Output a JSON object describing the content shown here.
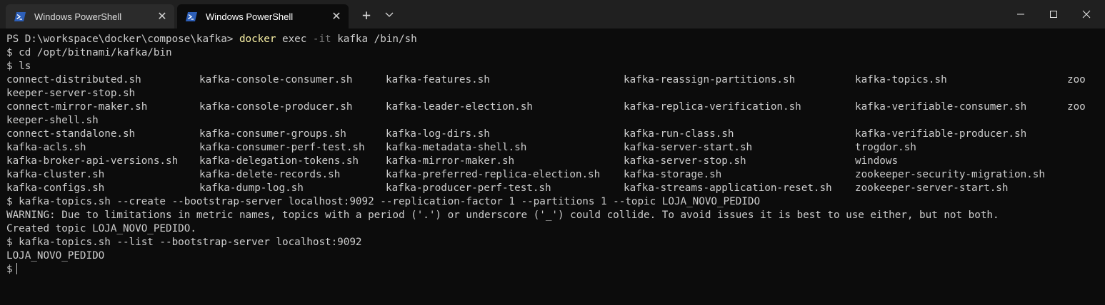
{
  "tabs": [
    {
      "label": "Windows PowerShell",
      "active": false,
      "close": "✕"
    },
    {
      "label": "Windows PowerShell",
      "active": true,
      "close": "✕"
    }
  ],
  "titlebar": {
    "new_tab_glyph": "+",
    "dropdown_icon": "chevron-down-icon",
    "window_controls": [
      "minimize-icon",
      "maximize-icon",
      "close-icon"
    ]
  },
  "terminal": {
    "prompt_ps": "PS D:\\workspace\\docker\\compose\\kafka> ",
    "cmd_docker": "docker",
    "cmd_exec": " exec ",
    "flag_it": "-it",
    "cmd_rest": " kafka /bin/sh",
    "line_cd": "$ cd /opt/bitnami/kafka/bin",
    "line_ls": "$ ls",
    "ls_rows": [
      [
        "connect-distributed.sh",
        "kafka-console-consumer.sh",
        "kafka-features.sh",
        "kafka-reassign-partitions.sh",
        "kafka-topics.sh",
        "zoo"
      ],
      [
        "keeper-server-stop.sh",
        "",
        "",
        "",
        "",
        ""
      ],
      [
        "connect-mirror-maker.sh",
        "kafka-console-producer.sh",
        "kafka-leader-election.sh",
        "kafka-replica-verification.sh",
        "kafka-verifiable-consumer.sh",
        "zoo"
      ],
      [
        "keeper-shell.sh",
        "",
        "",
        "",
        "",
        ""
      ],
      [
        "connect-standalone.sh",
        "kafka-consumer-groups.sh",
        "kafka-log-dirs.sh",
        "kafka-run-class.sh",
        "kafka-verifiable-producer.sh",
        ""
      ],
      [
        "kafka-acls.sh",
        "kafka-consumer-perf-test.sh",
        "kafka-metadata-shell.sh",
        "kafka-server-start.sh",
        "trogdor.sh",
        ""
      ],
      [
        "kafka-broker-api-versions.sh",
        "kafka-delegation-tokens.sh",
        "kafka-mirror-maker.sh",
        "kafka-server-stop.sh",
        "windows",
        ""
      ],
      [
        "kafka-cluster.sh",
        "kafka-delete-records.sh",
        "kafka-preferred-replica-election.sh",
        "kafka-storage.sh",
        "zookeeper-security-migration.sh",
        ""
      ],
      [
        "kafka-configs.sh",
        "kafka-dump-log.sh",
        "kafka-producer-perf-test.sh",
        "kafka-streams-application-reset.sh",
        "zookeeper-server-start.sh",
        ""
      ]
    ],
    "line_create": "$ kafka-topics.sh --create --bootstrap-server localhost:9092 --replication-factor 1 --partitions 1 --topic LOJA_NOVO_PEDIDO",
    "line_warning": "WARNING: Due to limitations in metric names, topics with a period ('.') or underscore ('_') could collide. To avoid issues it is best to use either, but not both.",
    "line_created": "Created topic LOJA_NOVO_PEDIDO.",
    "line_list": "$ kafka-topics.sh --list --bootstrap-server localhost:9092",
    "line_topic": "LOJA_NOVO_PEDIDO",
    "prompt_final": "$"
  },
  "colors": {
    "background": "#0c0c0c",
    "titlebar": "#202020",
    "text": "#cccccc",
    "command": "#f9f1a5",
    "flag": "#767676",
    "ps_icon": "#2d5fb8"
  }
}
